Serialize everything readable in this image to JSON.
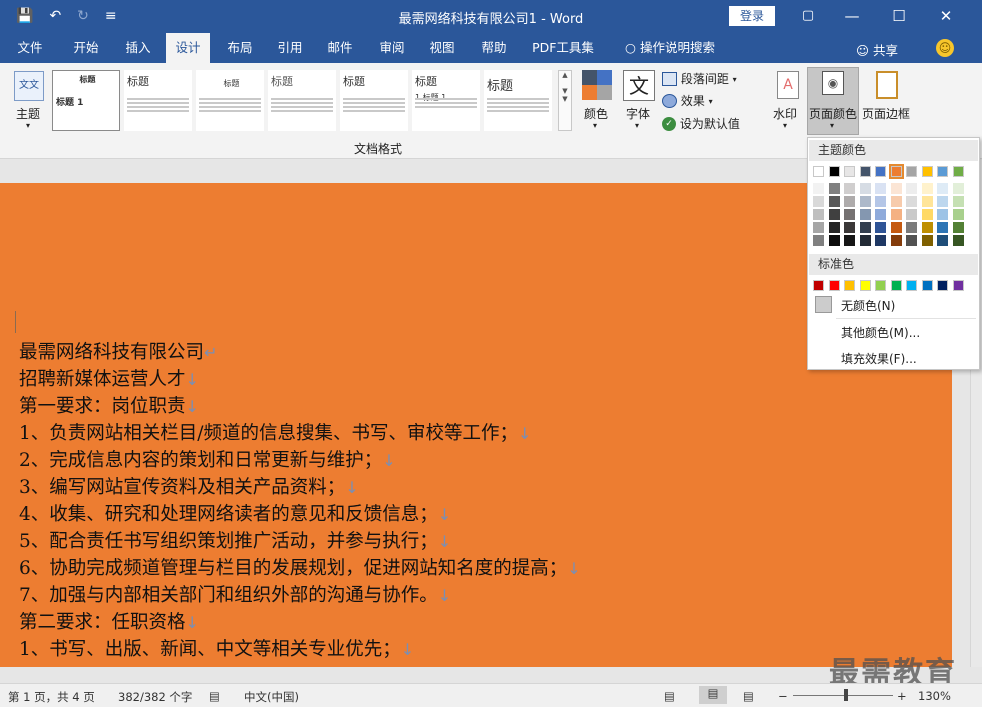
{
  "titlebar": {
    "doc_title": "最需网络科技有限公司1 - Word",
    "login": "登录",
    "qat": {
      "save_icon": "💾",
      "undo_icon": "↶",
      "redo_icon": "↻",
      "customize_icon": "≡"
    },
    "controls": {
      "restore_icon": "▢",
      "minimize": "—",
      "maximize": "☐",
      "close": "✕"
    }
  },
  "tabs": [
    "文件",
    "开始",
    "插入",
    "设计",
    "布局",
    "引用",
    "邮件",
    "审阅",
    "视图",
    "帮助",
    "PDF工具集",
    "操作说明搜索"
  ],
  "active_tab": "设计",
  "share": "共享",
  "ribbon": {
    "theme_label": "主题",
    "theme_glyph": "文文",
    "gallery_titles": [
      "标题",
      "标题",
      "标题",
      "标题",
      "标题",
      "标题",
      "标题"
    ],
    "gallery_sub": [
      "标题 1",
      "标题 1",
      "标题 1",
      "标题 1",
      "标题 1",
      "1 标题 1",
      "标题 1"
    ],
    "colors_label": "颜色",
    "fonts_label": "字体",
    "fonts_glyph": "文",
    "paragraph_spacing": "段落间距",
    "effects": "效果",
    "set_default": "设为默认值",
    "group_label": "文档格式",
    "watermark": "水印",
    "page_color": "页面颜色",
    "page_borders": "页面边框"
  },
  "color_panel": {
    "theme_colors_label": "主题颜色",
    "standard_colors_label": "标准色",
    "no_color": "无颜色(N)",
    "more_colors": "其他颜色(M)...",
    "fill_effects": "填充效果(F)...",
    "theme_colors": [
      "#ffffff",
      "#000000",
      "#e7e6e6",
      "#44546a",
      "#4472c4",
      "#ed7d31",
      "#a5a5a5",
      "#ffc000",
      "#5b9bd5",
      "#70ad47"
    ],
    "theme_shades": [
      [
        "#f2f2f2",
        "#d9d9d9",
        "#bfbfbf",
        "#a6a6a6",
        "#808080"
      ],
      [
        "#808080",
        "#595959",
        "#404040",
        "#262626",
        "#0d0d0d"
      ],
      [
        "#d0cece",
        "#aeabab",
        "#757171",
        "#3b3838",
        "#161616"
      ],
      [
        "#d6dce4",
        "#adb9ca",
        "#8497b0",
        "#333f4f",
        "#222a35"
      ],
      [
        "#d9e2f3",
        "#b4c6e7",
        "#8eaadb",
        "#2f5496",
        "#1f3864"
      ],
      [
        "#fbe5d5",
        "#f7cbac",
        "#f4b183",
        "#c55a11",
        "#843c0b"
      ],
      [
        "#ededed",
        "#dbdbdb",
        "#c9c9c9",
        "#7b7b7b",
        "#525252"
      ],
      [
        "#fff2cc",
        "#ffe599",
        "#ffd965",
        "#bf8f00",
        "#7f6000"
      ],
      [
        "#deebf6",
        "#bdd7ee",
        "#9dc3e6",
        "#2e75b5",
        "#1f4e79"
      ],
      [
        "#e2efd9",
        "#c5e0b3",
        "#a8d08d",
        "#538135",
        "#375623"
      ]
    ],
    "standard_colors": [
      "#c00000",
      "#ff0000",
      "#ffc000",
      "#ffff00",
      "#92d050",
      "#00b050",
      "#00b0f0",
      "#0070c0",
      "#002060",
      "#7030a0"
    ]
  },
  "document": {
    "page_color": "#ed7d31",
    "lines": [
      "最需网络科技有限公司",
      "招聘新媒体运营人才",
      "第一要求：岗位职责",
      "1、负责网站相关栏目/频道的信息搜集、书写、审校等工作；",
      "2、完成信息内容的策划和日常更新与维护；",
      "3、编写网站宣传资料及相关产品资料；",
      "4、收集、研究和处理网络读者的意见和反馈信息；",
      "5、配合责任书写组织策划推广活动，并参与执行；",
      "6、协助完成频道管理与栏目的发展规划，促进网站知名度的提高；",
      "7、加强与内部相关部门和组织外部的沟通与协作。",
      "第二要求：任职资格",
      "1、书写、出版、新闻、中文等相关专业优先；"
    ],
    "marks": [
      "↵",
      "↓",
      "↓",
      "↓",
      "↓",
      "↓",
      "↓",
      "↓",
      "↓",
      "↓",
      "↓",
      "↓"
    ]
  },
  "statusbar": {
    "page": "第 1 页，共 4 页",
    "words": "382/382 个字",
    "language": "中文(中国)",
    "zoom": "130%",
    "zoom_out": "−",
    "zoom_in": "+"
  },
  "watermark_logo": "最需教育"
}
